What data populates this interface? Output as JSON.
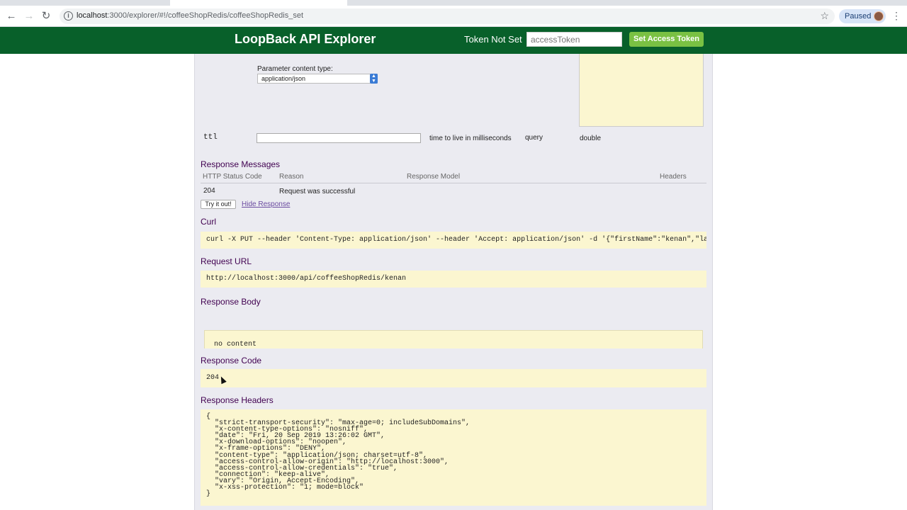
{
  "browser": {
    "url_host": "localhost",
    "url_rest": ":3000/explorer/#!/coffeeShopRedis/coffeeShopRedis_set",
    "profile_status": "Paused"
  },
  "header": {
    "brand": "LoopBack API Explorer",
    "token_status": "Token Not Set",
    "token_placeholder": "accessToken",
    "set_token_label": "Set Access Token",
    "brand_color": "#08602a",
    "button_color": "#7ac143"
  },
  "parameters": {
    "content_type_label": "Parameter content type:",
    "content_type_value": "application/json",
    "ttl": {
      "name": "ttl",
      "description": "time to live in milliseconds",
      "param_type": "query",
      "data_type": "double"
    }
  },
  "response_messages": {
    "title": "Response Messages",
    "columns": [
      "HTTP Status Code",
      "Reason",
      "Response Model",
      "Headers"
    ],
    "rows": [
      {
        "code": "204",
        "reason": "Request was successful"
      }
    ]
  },
  "actions": {
    "try_label": "Try it out!",
    "hide_label": "Hide Response"
  },
  "curl": {
    "title": "Curl",
    "command": "curl -X PUT --header 'Content-Type: application/json' --header 'Accept: application/json' -d '{\"firstName\":\"kenan\",\"lastName\":\"hancer\"}'"
  },
  "request_url": {
    "title": "Request URL",
    "value": "http://localhost:3000/api/coffeeShopRedis/kenan"
  },
  "response_body": {
    "title": "Response Body",
    "value": "no content"
  },
  "response_code": {
    "title": "Response Code",
    "value": "204"
  },
  "response_headers": {
    "title": "Response Headers",
    "value": "{\n  \"strict-transport-security\": \"max-age=0; includeSubDomains\",\n  \"x-content-type-options\": \"nosniff\",\n  \"date\": \"Fri, 20 Sep 2019 13:26:02 GMT\",\n  \"x-download-options\": \"noopen\",\n  \"x-frame-options\": \"DENY\",\n  \"content-type\": \"application/json; charset=utf-8\",\n  \"access-control-allow-origin\": \"http://localhost:3000\",\n  \"access-control-allow-credentials\": \"true\",\n  \"connection\": \"keep-alive\",\n  \"vary\": \"Origin, Accept-Encoding\",\n  \"x-xss-protection\": \"1; mode=block\"\n}"
  }
}
